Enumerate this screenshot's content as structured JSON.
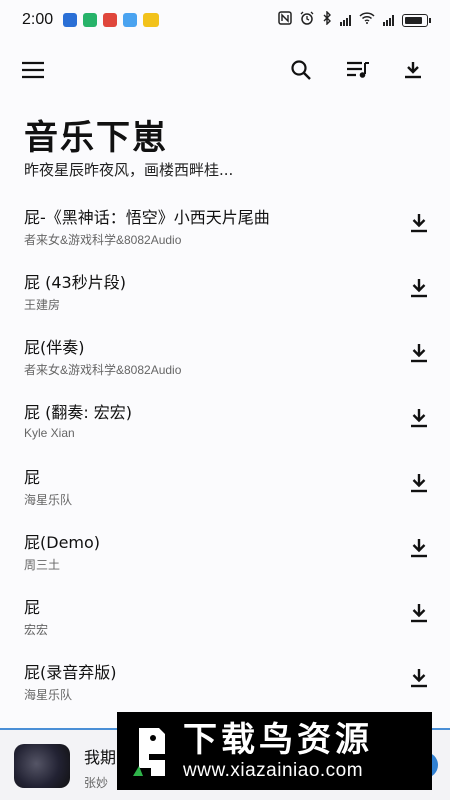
{
  "status_bar": {
    "time": "2:00",
    "notification_colors": [
      "#2a6fd6",
      "#27b36a",
      "#e0463c",
      "#4aa3f0",
      "#f2c21b"
    ],
    "right_icons": [
      "nfc-icon",
      "alarm-icon",
      "bluetooth-icon",
      "signal-icon",
      "wifi-icon",
      "signal-icon",
      "battery-icon"
    ]
  },
  "toolbar": {
    "menu_icon": "menu-icon",
    "search_icon": "search-icon",
    "queue_icon": "playlist-icon",
    "download_icon": "download-icon"
  },
  "header": {
    "title": "音乐下崽",
    "subtitle": "昨夜星辰昨夜风，画楼西畔桂..."
  },
  "songs": [
    {
      "title": "屁-《黑神话：悟空》小西天片尾曲",
      "artist": "者来女&游戏科学&8082Audio"
    },
    {
      "title": "屁 (43秒片段)",
      "artist": "王建房"
    },
    {
      "title": "屁(伴奏)",
      "artist": "者来女&游戏科学&8082Audio"
    },
    {
      "title": "屁 (翻奏: 宏宏)",
      "artist": "Kyle Xian"
    },
    {
      "title": "屁",
      "artist": "海星乐队"
    },
    {
      "title": "屁(Demo)",
      "artist": "周三土"
    },
    {
      "title": "屁",
      "artist": "宏宏"
    },
    {
      "title": "屁(录音弃版)",
      "artist": "海星乐队"
    }
  ],
  "player": {
    "title": "我期",
    "artist": "张妙",
    "accent": "#2f7fd1"
  },
  "watermark": {
    "name": "下载鸟资源",
    "url": "www.xiazainiao.com"
  }
}
